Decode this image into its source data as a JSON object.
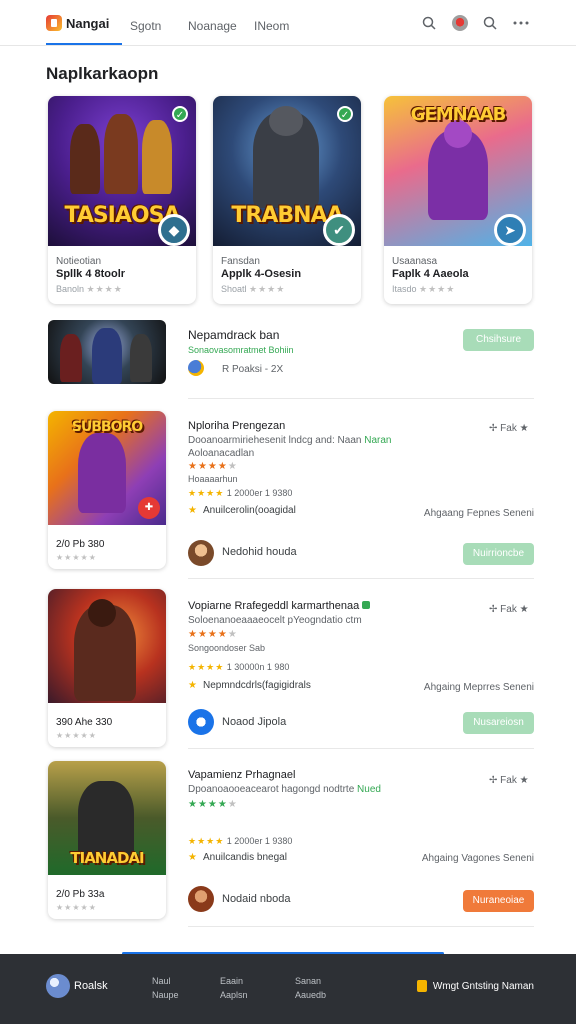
{
  "header": {
    "brand": "Nangai",
    "tabs": [
      "Sgotn",
      "Noanage",
      "INeom"
    ]
  },
  "section_title": "Naplkarkaopn",
  "featured": [
    {
      "art_title": "TASIAOSA",
      "label": "Notieotian",
      "name": "Spllk 4 8toolr",
      "sub": "Banoln"
    },
    {
      "art_title": "TRABNAA",
      "label": "Fansdan",
      "name": "Applk 4-Osesin",
      "sub": "Shoatl"
    },
    {
      "art_title": "GEMNAAB",
      "label": "Usaanasa",
      "name": "Faplk 4 Aaeola",
      "sub": "Itasdo"
    }
  ],
  "banner": {
    "title": "Nepamdrack ban",
    "subtitle": "Sonaovasomratmet Bohiin",
    "meta": "R Poaksi - 2X",
    "button": "Chsihsure"
  },
  "items": [
    {
      "title": "Nploriha Prengezan",
      "desc": "Dooanoarmiriehesenit lndcg and: Naan",
      "desc_highlight": "Naran",
      "desc2": "Aoloanacadlan",
      "sub": "Hoaaaarhun",
      "rating_text": "1 2000er 1 9380",
      "feature": "Anuilcerolin(ooagidal",
      "right_meta": "Ahgaang Fepnes Seneni",
      "count": "Fak",
      "developer": "Nedohid houda",
      "button": "Nuirrioncbe",
      "price": "2/0 Pb 380",
      "art_title": "SUBBORO"
    },
    {
      "title": "Vopiarne Rrafegeddl karmarthenaa",
      "desc": "Soloenanoeaaaeocelt pYeogndatio ctm",
      "desc_highlight": "",
      "desc2": "",
      "sub": "Songoondoser Sab",
      "rating_text": "1 30000n 1 980",
      "feature": "Nepmndcdrls(fagigidrals",
      "right_meta": "Ahgaing Meprres Seneni",
      "count": "Fak",
      "developer": "Noaod Jipola",
      "button": "Nusareiosn",
      "price": "390 Ahe 330",
      "art_title": ""
    },
    {
      "title": "Vapamienz Prhagnael",
      "desc": "Dpoanoaooeacearot hagongd nodtrte",
      "desc_highlight": "Nued",
      "desc2": "",
      "sub": "",
      "rating_text": "1 2000er 1 9380",
      "feature": "Anuilcandis bnegal",
      "right_meta": "Ahgaing Vagones Seneni",
      "count": "Fak",
      "developer": "Nodaid nboda",
      "button": "Nuraneoiae",
      "price": "2/0 Pb 33a",
      "art_title": "TIANADAI"
    }
  ],
  "footer": {
    "brand": "Roalsk",
    "links": [
      [
        "Naul",
        "Naupe"
      ],
      [
        "Eaain",
        "Aaplsn"
      ],
      [
        "Sanan",
        "Aauedb"
      ]
    ],
    "right": "Wmgt Gntsting Naman"
  },
  "colors": {
    "accent": "#1a73e8",
    "green": "#34a853",
    "orange": "#f07a3a",
    "footer_bg": "#2d3035"
  }
}
